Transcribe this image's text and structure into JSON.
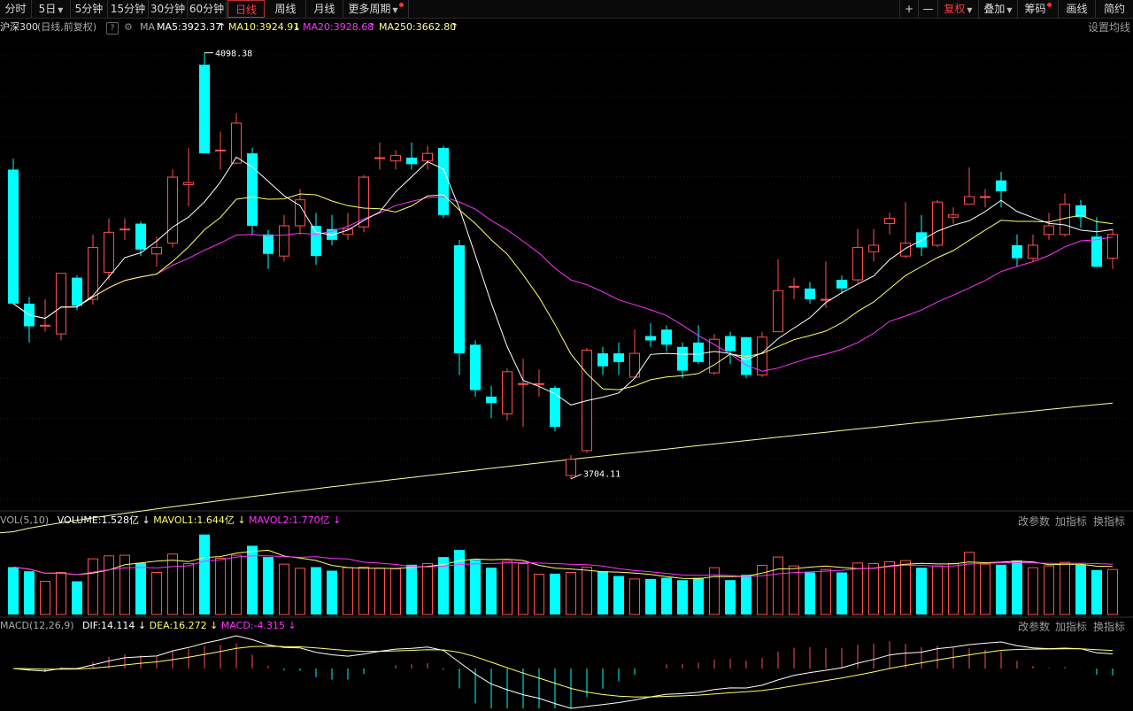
{
  "toolbar": {
    "left_tabs": [
      {
        "label": "分时",
        "active": false
      },
      {
        "label": "5日",
        "dropdown": true
      },
      {
        "label": "5分钟"
      },
      {
        "label": "15分钟"
      },
      {
        "label": "30分钟"
      },
      {
        "label": "60分钟"
      },
      {
        "label": "日线",
        "active": true
      },
      {
        "label": "周线"
      },
      {
        "label": "月线"
      },
      {
        "label": "更多周期",
        "dropdown": true,
        "dot": true
      }
    ],
    "plus": "+",
    "minus": "—",
    "fuquan": "复权",
    "diejia": "叠加",
    "chouma": "筹码",
    "huaxian": "画线",
    "jianyue": "简约"
  },
  "info": {
    "name": "沪深300",
    "mode": "(日线,前复权)",
    "help": "?",
    "ma_label": "MA",
    "ma5": "MA5:3923.37",
    "ma10": "MA10:3924.91",
    "ma20": "MA20:3928.68",
    "ma250": "MA250:3662.80",
    "settings": "设置均线"
  },
  "annotations": {
    "high": "4098.38",
    "low": "3704.11"
  },
  "vol": {
    "title": "VOL(5,10)",
    "volume": "VOLUME:1.528亿",
    "mavol1": "MAVOL1:1.644亿",
    "mavol2": "MAVOL2:1.770亿",
    "change_param": "改参数",
    "add_indicator": "加指标",
    "switch_indicator": "换指标"
  },
  "macd": {
    "title": "MACD(12,26,9)",
    "dif": "DIF:14.114",
    "dea": "DEA:16.272",
    "macd": "MACD:-4.315",
    "change_param": "改参数",
    "add_indicator": "加指标",
    "switch_indicator": "换指标"
  },
  "colors": {
    "up": "#ff5050",
    "down": "#00ffff",
    "ma5": "#ffffff",
    "ma10": "#ffff66",
    "ma20": "#ff33ff",
    "ma250": "#ffff99",
    "active": "#ff3b3b"
  },
  "chart_data": {
    "type": "candlestick",
    "ylim": [
      3680,
      4110
    ],
    "high_label": 4098.38,
    "low_label": 3704.11,
    "candles": [
      {
        "o": 3990,
        "c": 3866,
        "h": 4000,
        "l": 3866,
        "v": 0.8
      },
      {
        "o": 3866,
        "c": 3845,
        "h": 3872,
        "l": 3830,
        "v": 0.73
      },
      {
        "o": 3846,
        "c": 3846,
        "h": 3870,
        "l": 3840,
        "v": 0.56
      },
      {
        "o": 3838,
        "c": 3894,
        "h": 3894,
        "l": 3832,
        "v": 0.71
      },
      {
        "o": 3890,
        "c": 3864,
        "h": 3892,
        "l": 3860,
        "v": 0.56
      },
      {
        "o": 3870,
        "c": 3918,
        "h": 3930,
        "l": 3865,
        "v": 0.94
      },
      {
        "o": 3895,
        "c": 3932,
        "h": 3945,
        "l": 3888,
        "v": 0.99
      },
      {
        "o": 3935,
        "c": 3935,
        "h": 3945,
        "l": 3925,
        "v": 1.0
      },
      {
        "o": 3940,
        "c": 3916,
        "h": 3942,
        "l": 3910,
        "v": 0.87
      },
      {
        "o": 3912,
        "c": 3918,
        "h": 3928,
        "l": 3900,
        "v": 0.71
      },
      {
        "o": 3922,
        "c": 3983,
        "h": 3990,
        "l": 3918,
        "v": 1.02
      },
      {
        "o": 3976,
        "c": 3978,
        "h": 4010,
        "l": 3956,
        "v": 0.86
      },
      {
        "o": 4087,
        "c": 4005,
        "h": 4098,
        "l": 4005,
        "v": 1.35
      },
      {
        "o": 4008,
        "c": 4008,
        "h": 4025,
        "l": 3990,
        "v": 0.95
      },
      {
        "o": 3996,
        "c": 4033,
        "h": 4042,
        "l": 3995,
        "v": 1.0
      },
      {
        "o": 4005,
        "c": 3938,
        "h": 4010,
        "l": 3930,
        "v": 1.16
      },
      {
        "o": 3930,
        "c": 3912,
        "h": 3934,
        "l": 3898,
        "v": 0.97
      },
      {
        "o": 3910,
        "c": 3938,
        "h": 3948,
        "l": 3905,
        "v": 0.85
      },
      {
        "o": 3938,
        "c": 3962,
        "h": 3972,
        "l": 3930,
        "v": 0.78
      },
      {
        "o": 3938,
        "c": 3910,
        "h": 3950,
        "l": 3902,
        "v": 0.8
      },
      {
        "o": 3935,
        "c": 3925,
        "h": 3948,
        "l": 3920,
        "v": 0.74
      },
      {
        "o": 3930,
        "c": 3935,
        "h": 3950,
        "l": 3925,
        "v": 0.79
      },
      {
        "o": 3937,
        "c": 3983,
        "h": 3985,
        "l": 3932,
        "v": 0.8
      },
      {
        "o": 4001,
        "c": 4001,
        "h": 4015,
        "l": 3990,
        "v": 0.78
      },
      {
        "o": 3998,
        "c": 4003,
        "h": 4008,
        "l": 3990,
        "v": 0.77
      },
      {
        "o": 4001,
        "c": 3995,
        "h": 4015,
        "l": 3990,
        "v": 0.84
      },
      {
        "o": 3998,
        "c": 4005,
        "h": 4012,
        "l": 3990,
        "v": 0.86
      },
      {
        "o": 4010,
        "c": 3948,
        "h": 4012,
        "l": 3945,
        "v": 0.97
      },
      {
        "o": 3920,
        "c": 3820,
        "h": 3925,
        "l": 3800,
        "v": 1.09
      },
      {
        "o": 3828,
        "c": 3786,
        "h": 3832,
        "l": 3780,
        "v": 0.92
      },
      {
        "o": 3780,
        "c": 3774,
        "h": 3790,
        "l": 3760,
        "v": 0.79
      },
      {
        "o": 3764,
        "c": 3803,
        "h": 3806,
        "l": 3758,
        "v": 0.9
      },
      {
        "o": 3792,
        "c": 3792,
        "h": 3815,
        "l": 3752,
        "v": 0.86
      },
      {
        "o": 3792,
        "c": 3792,
        "h": 3805,
        "l": 3780,
        "v": 0.68
      },
      {
        "o": 3788,
        "c": 3752,
        "h": 3790,
        "l": 3748,
        "v": 0.69
      },
      {
        "o": 3707,
        "c": 3722,
        "h": 3726,
        "l": 3704,
        "v": 0.71
      },
      {
        "o": 3730,
        "c": 3823,
        "h": 3825,
        "l": 3728,
        "v": 0.8
      },
      {
        "o": 3820,
        "c": 3808,
        "h": 3826,
        "l": 3800,
        "v": 0.73
      },
      {
        "o": 3820,
        "c": 3812,
        "h": 3830,
        "l": 3800,
        "v": 0.65
      },
      {
        "o": 3798,
        "c": 3820,
        "h": 3842,
        "l": 3798,
        "v": 0.6
      },
      {
        "o": 3836,
        "c": 3832,
        "h": 3848,
        "l": 3826,
        "v": 0.6
      },
      {
        "o": 3842,
        "c": 3828,
        "h": 3846,
        "l": 3822,
        "v": 0.62
      },
      {
        "o": 3826,
        "c": 3804,
        "h": 3830,
        "l": 3797,
        "v": 0.58
      },
      {
        "o": 3830,
        "c": 3812,
        "h": 3846,
        "l": 3810,
        "v": 0.62
      },
      {
        "o": 3802,
        "c": 3833,
        "h": 3838,
        "l": 3800,
        "v": 0.79
      },
      {
        "o": 3836,
        "c": 3822,
        "h": 3840,
        "l": 3810,
        "v": 0.58
      },
      {
        "o": 3835,
        "c": 3800,
        "h": 3835,
        "l": 3797,
        "v": 0.67
      },
      {
        "o": 3800,
        "c": 3835,
        "h": 3840,
        "l": 3798,
        "v": 0.83
      },
      {
        "o": 3840,
        "c": 3878,
        "h": 3907,
        "l": 3840,
        "v": 0.97
      },
      {
        "o": 3882,
        "c": 3882,
        "h": 3890,
        "l": 3870,
        "v": 0.82
      },
      {
        "o": 3880,
        "c": 3870,
        "h": 3886,
        "l": 3866,
        "v": 0.71
      },
      {
        "o": 3870,
        "c": 3870,
        "h": 3905,
        "l": 3862,
        "v": 0.76
      },
      {
        "o": 3888,
        "c": 3880,
        "h": 3892,
        "l": 3875,
        "v": 0.71
      },
      {
        "o": 3888,
        "c": 3918,
        "h": 3935,
        "l": 3885,
        "v": 0.87
      },
      {
        "o": 3914,
        "c": 3920,
        "h": 3935,
        "l": 3905,
        "v": 0.86
      },
      {
        "o": 3940,
        "c": 3945,
        "h": 3950,
        "l": 3930,
        "v": 0.89
      },
      {
        "o": 3910,
        "c": 3922,
        "h": 3960,
        "l": 3908,
        "v": 0.91
      },
      {
        "o": 3932,
        "c": 3918,
        "h": 3948,
        "l": 3910,
        "v": 0.79
      },
      {
        "o": 3920,
        "c": 3960,
        "h": 3962,
        "l": 3918,
        "v": 0.82
      },
      {
        "o": 3946,
        "c": 3948,
        "h": 3955,
        "l": 3940,
        "v": 0.86
      },
      {
        "o": 3958,
        "c": 3965,
        "h": 3992,
        "l": 3958,
        "v": 1.05
      },
      {
        "o": 3965,
        "c": 3965,
        "h": 3972,
        "l": 3955,
        "v": 0.85
      },
      {
        "o": 3980,
        "c": 3970,
        "h": 3988,
        "l": 3955,
        "v": 0.84
      },
      {
        "o": 3920,
        "c": 3908,
        "h": 3930,
        "l": 3900,
        "v": 0.91
      },
      {
        "o": 3908,
        "c": 3920,
        "h": 3930,
        "l": 3905,
        "v": 0.79
      },
      {
        "o": 3930,
        "c": 3938,
        "h": 3950,
        "l": 3925,
        "v": 0.82
      },
      {
        "o": 3930,
        "c": 3958,
        "h": 3968,
        "l": 3928,
        "v": 0.88
      },
      {
        "o": 3957,
        "c": 3946,
        "h": 3962,
        "l": 3936,
        "v": 0.84
      },
      {
        "o": 3928,
        "c": 3900,
        "h": 3946,
        "l": 3900,
        "v": 0.75
      },
      {
        "o": 3908,
        "c": 3930,
        "h": 3935,
        "l": 3898,
        "v": 0.76
      }
    ],
    "ma250": {
      "from": 3655,
      "to": 3774
    }
  }
}
